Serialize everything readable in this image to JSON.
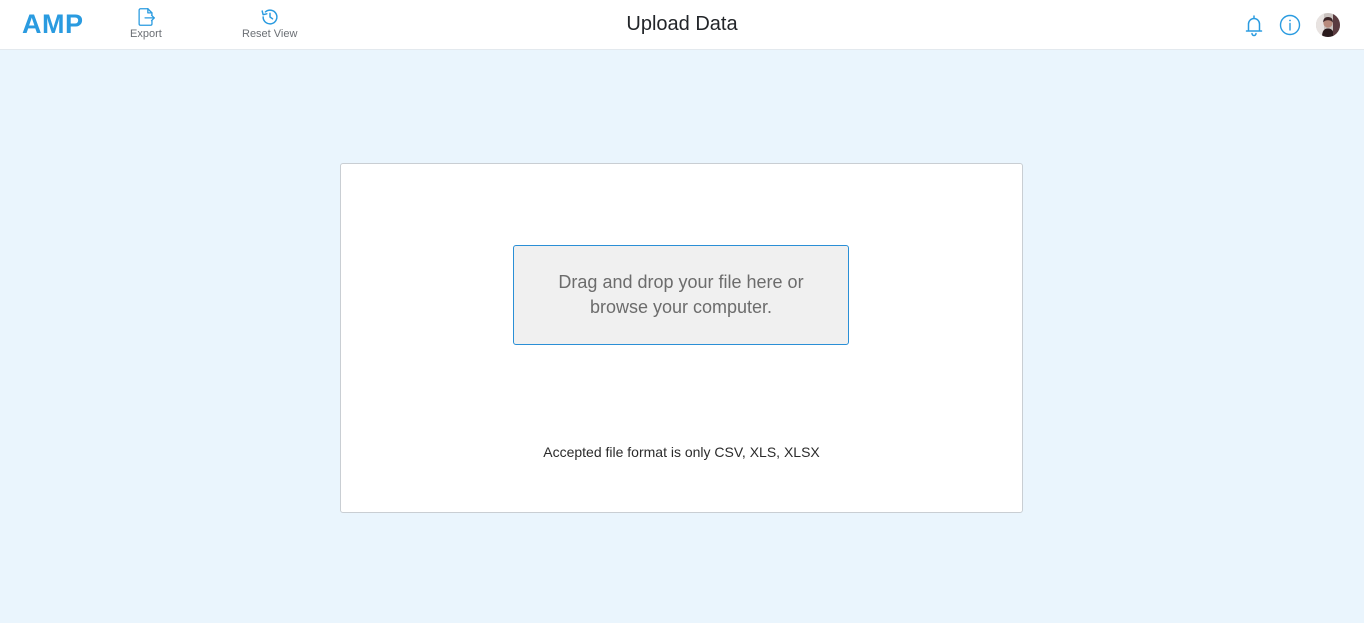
{
  "app": {
    "logo": "AMP",
    "brand_color": "#2a9be0"
  },
  "toolbar": {
    "export_label": "Export",
    "export_icon": "export-file-icon",
    "reset_label": "Reset View",
    "reset_icon": "history-icon"
  },
  "header": {
    "title": "Upload Data",
    "icons": [
      "bell-icon",
      "info-icon",
      "user-avatar"
    ]
  },
  "upload": {
    "dropzone_text": "Drag and drop your file here or browse your computer.",
    "accepted_formats": "Accepted file format is only CSV, XLS, XLSX",
    "accent_color": "#2a8fd6"
  },
  "colors": {
    "background": "#eaf5fd",
    "card": "#ffffff",
    "dropzone_bg": "#f0f0f0"
  }
}
